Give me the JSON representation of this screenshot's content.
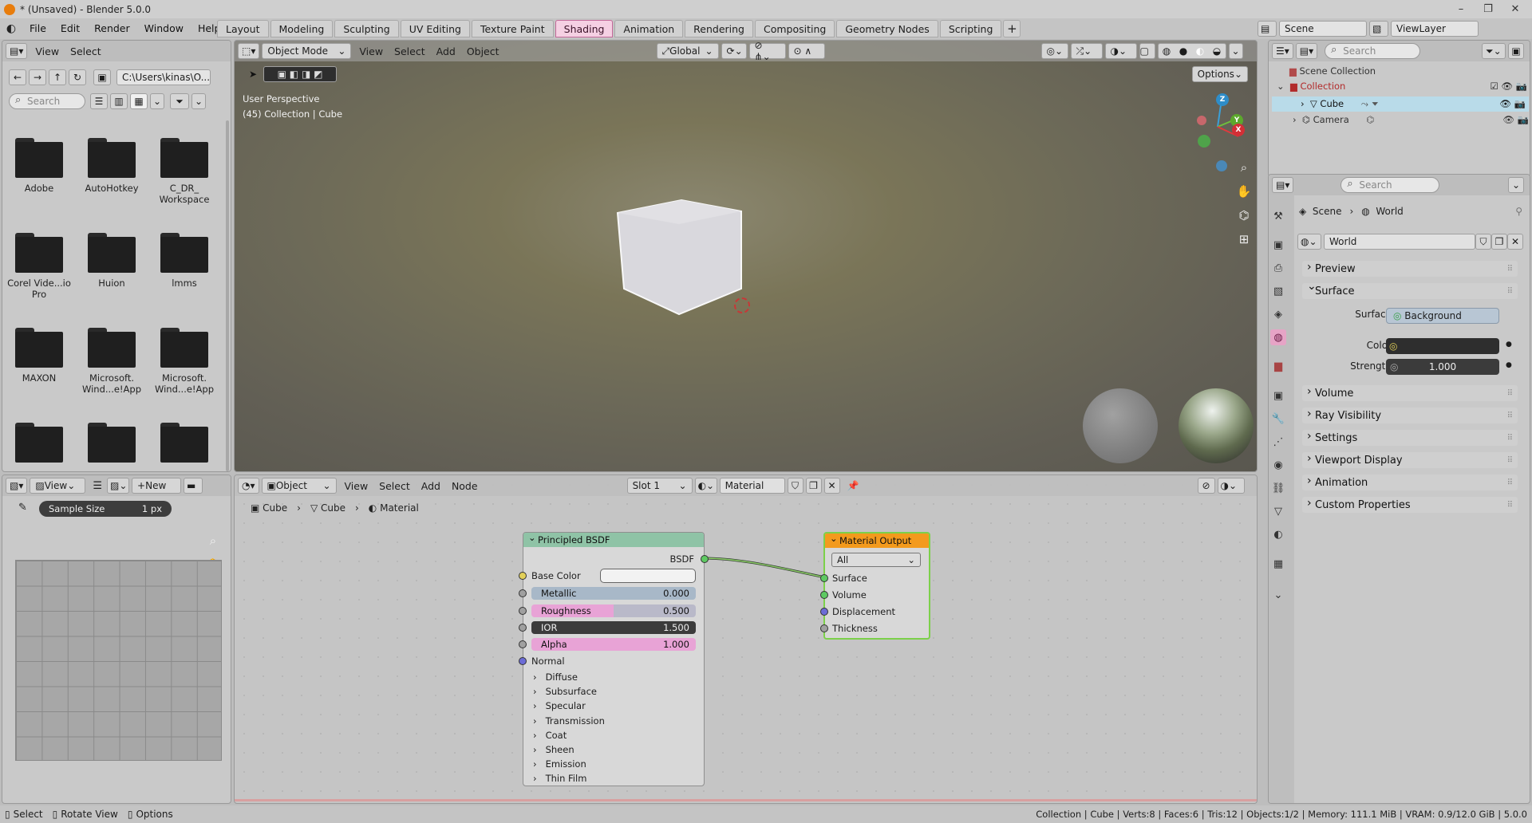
{
  "window": {
    "title": "* (Unsaved) - Blender 5.0.0",
    "controls": [
      "–",
      "❐",
      "✕"
    ]
  },
  "menu": [
    "File",
    "Edit",
    "Render",
    "Window",
    "Help"
  ],
  "workspaces": [
    "Layout",
    "Modeling",
    "Sculpting",
    "UV Editing",
    "Texture Paint",
    "Shading",
    "Animation",
    "Rendering",
    "Compositing",
    "Geometry Nodes",
    "Scripting"
  ],
  "active_workspace": "Shading",
  "scene_selector": {
    "scene": "Scene",
    "view_layer": "ViewLayer"
  },
  "file_browser": {
    "header": [
      "View",
      "Select"
    ],
    "path": "C:\\Users\\kinas\\O...",
    "search_placeholder": "Search",
    "folders": [
      "Adobe",
      "AutoHotkey",
      "C_DR_ Workspace",
      "Corel Vide...io Pro",
      "Huion",
      "lmms",
      "MAXON",
      "Microsoft. Wind...e!App",
      "Microsoft. Wind...e!App",
      "",
      "",
      ""
    ]
  },
  "viewport": {
    "mode": "Object Mode",
    "menus": [
      "View",
      "Select",
      "Add",
      "Object"
    ],
    "orientation": "Global",
    "options_label": "Options",
    "overlay_line1": "User Perspective",
    "overlay_line2": "(45) Collection | Cube",
    "gizmo_axes": [
      "Z",
      "Y",
      "X"
    ]
  },
  "image_editor": {
    "view_label": "View",
    "new_label": "New",
    "sample_size_label": "Sample Size",
    "sample_size_value": "1 px"
  },
  "node_editor": {
    "object_type": "Object",
    "menus": [
      "View",
      "Select",
      "Add",
      "Node"
    ],
    "slot": "Slot 1",
    "material_name": "Material",
    "breadcrumb": [
      "Cube",
      "Cube",
      "Material"
    ],
    "bsdf": {
      "title": "Principled BSDF",
      "output": "BSDF",
      "base_color_label": "Base Color",
      "metallic": {
        "label": "Metallic",
        "value": "0.000"
      },
      "roughness": {
        "label": "Roughness",
        "value": "0.500"
      },
      "ior": {
        "label": "IOR",
        "value": "1.500"
      },
      "alpha": {
        "label": "Alpha",
        "value": "1.000"
      },
      "normal_label": "Normal",
      "panels": [
        "Diffuse",
        "Subsurface",
        "Specular",
        "Transmission",
        "Coat",
        "Sheen",
        "Emission",
        "Thin Film"
      ]
    },
    "output_node": {
      "title": "Material Output",
      "target": "All",
      "inputs": [
        "Surface",
        "Volume",
        "Displacement",
        "Thickness"
      ]
    }
  },
  "outliner": {
    "search_placeholder": "Search",
    "root": "Scene Collection",
    "items": [
      "Collection",
      "Cube",
      "Camera"
    ]
  },
  "properties": {
    "search_placeholder": "Search",
    "breadcrumb": [
      "Scene",
      "World"
    ],
    "world_name": "World",
    "preview_label": "Preview",
    "surface_label": "Surface",
    "surface_field_label": "Surface",
    "surface_value": "Background",
    "color_label": "Color",
    "strength_label": "Strength",
    "strength_value": "1.000",
    "panels": [
      "Volume",
      "Ray Visibility",
      "Settings",
      "Viewport Display",
      "Animation",
      "Custom Properties"
    ]
  },
  "statusbar": {
    "left": [
      "Select",
      "Rotate View",
      "Options"
    ],
    "right": "Collection | Cube | Verts:8 | Faces:6 | Tris:12 | Objects:1/2 | Memory: 111.1 MiB | VRAM: 0.9/12.0 GiB | 5.0.0"
  },
  "colors": {
    "accent_active_tab": "#f5d0e3",
    "material_output_header": "#f39a1d",
    "bsdf_header": "#8fc3a6",
    "roughness_fill": "#e8a3d6",
    "selected_row": "#b9dbe9"
  }
}
